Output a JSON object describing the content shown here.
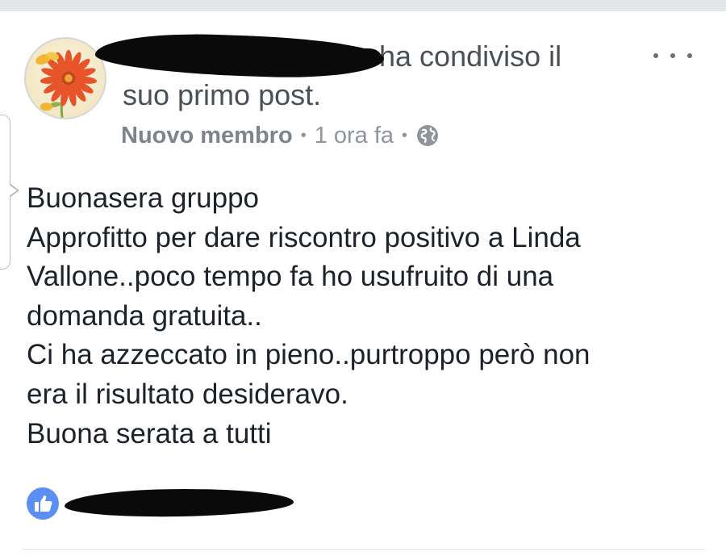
{
  "post": {
    "header_line1": "ha condiviso il",
    "header_line2": "suo primo post.",
    "role": "Nuovo membro",
    "separator": "•",
    "time": "1 ora fa",
    "body_lines": [
      "Buonasera gruppo",
      "Approfitto per dare riscontro positivo a Linda",
      "Vallone..poco tempo fa ho usufruito di una",
      "domanda gratuita..",
      "Ci ha azzeccato in pieno..purtroppo però non",
      "era il risultato desideravo.",
      "Buona serata a tutti"
    ]
  },
  "icons": {
    "more": "more-horizontal-icon",
    "privacy": "globe-icon",
    "reaction": "thumbs-up-icon"
  },
  "colors": {
    "secondary_text": "#90949c",
    "body_text": "#1d2129",
    "like_blue": "#5b8ff1"
  }
}
